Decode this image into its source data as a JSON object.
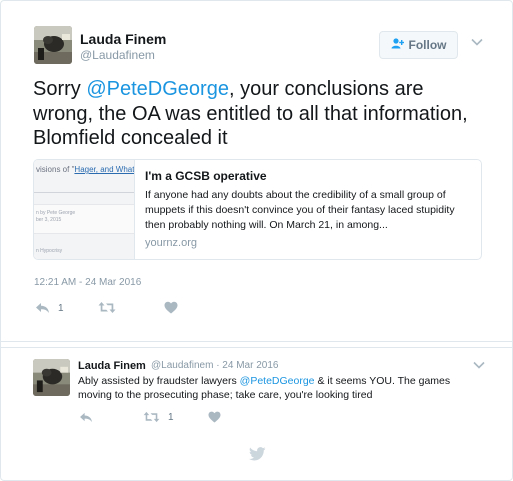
{
  "tweet": {
    "display_name": "Lauda Finem",
    "handle": "@Laudafinem",
    "follow_label": "Follow",
    "text_before": "Sorry ",
    "mention": "@PeteDGeorge",
    "text_after": ", your conclusions are wrong, the OA was entitled to all that information, Blomfield concealed it",
    "link_card": {
      "thumb_text_prefix": "visions of \"",
      "thumb_text_link": "Hager, and What",
      "thumb_small_1": "n by Pete George",
      "thumb_small_2": "ber 3, 2015",
      "thumb_small_3": "n Hypocrisy",
      "title": "I'm a GCSB operative",
      "description": "If anyone had any doubts about the credibility of a small group of muppets if this doesn't convince you of their fantasy laced stupidity then probably nothing will. On March 21, in among...",
      "domain": "yournz.org"
    },
    "timestamp": "12:21 AM - 24 Mar 2016",
    "reply_count": "1",
    "retweet_count": "",
    "like_count": ""
  },
  "reply": {
    "display_name": "Lauda Finem",
    "handle_date": "@Laudafinem · 24 Mar 2016",
    "text_before": "Ably assisted by fraudster lawyers ",
    "mention": "@PeteDGeorge",
    "text_after": " & it seems YOU. The games moving to the prosecuting phase; take care, you're looking tired",
    "reply_count": "",
    "retweet_count": "1",
    "like_count": ""
  },
  "icons": [
    "person-plus-icon",
    "chevron-down-icon",
    "reply-icon",
    "retweet-icon",
    "heart-icon",
    "twitter-bird-icon"
  ],
  "colors": {
    "accent": "#1da1f2",
    "mention": "#1b95e0",
    "muted": "#8899a6",
    "icon": "#aab8c2"
  }
}
